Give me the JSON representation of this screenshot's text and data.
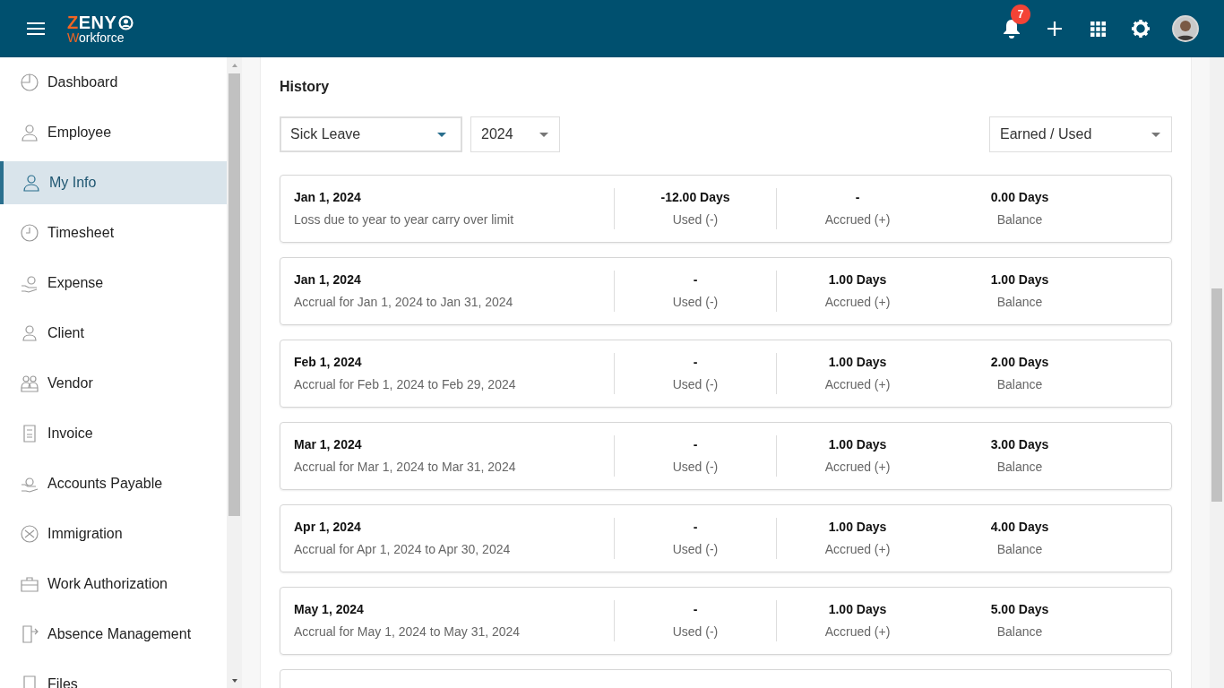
{
  "header": {
    "logo": {
      "top": "ZENY",
      "bottom": "Workforce"
    },
    "notifications": {
      "count": "7"
    }
  },
  "sidebar": {
    "items": [
      {
        "label": "Dashboard",
        "selected": false
      },
      {
        "label": "Employee",
        "selected": false
      },
      {
        "label": "My Info",
        "selected": true
      },
      {
        "label": "Timesheet",
        "selected": false
      },
      {
        "label": "Expense",
        "selected": false
      },
      {
        "label": "Client",
        "selected": false
      },
      {
        "label": "Vendor",
        "selected": false
      },
      {
        "label": "Invoice",
        "selected": false
      },
      {
        "label": "Accounts Payable",
        "selected": false
      },
      {
        "label": "Immigration",
        "selected": false
      },
      {
        "label": "Work Authorization",
        "selected": false
      },
      {
        "label": "Absence Management",
        "selected": false
      },
      {
        "label": "Files",
        "selected": false
      }
    ]
  },
  "history": {
    "title": "History",
    "filters": {
      "leave_type": "Sick Leave",
      "year": "2024",
      "view": "Earned / Used"
    },
    "records": [
      {
        "date": "Jan 1, 2024",
        "description": "Loss due to year to year carry over limit",
        "used": "-12.00 Days",
        "used_label": "Used (-)",
        "accrued": "-",
        "accrued_label": "Accrued (+)",
        "balance": "0.00 Days",
        "balance_label": "Balance"
      },
      {
        "date": "Jan 1, 2024",
        "description": "Accrual for Jan 1, 2024 to Jan 31, 2024",
        "used": "-",
        "used_label": "Used (-)",
        "accrued": "1.00 Days",
        "accrued_label": "Accrued (+)",
        "balance": "1.00 Days",
        "balance_label": "Balance"
      },
      {
        "date": "Feb 1, 2024",
        "description": "Accrual for Feb 1, 2024 to Feb 29, 2024",
        "used": "-",
        "used_label": "Used (-)",
        "accrued": "1.00 Days",
        "accrued_label": "Accrued (+)",
        "balance": "2.00 Days",
        "balance_label": "Balance"
      },
      {
        "date": "Mar 1, 2024",
        "description": "Accrual for Mar 1, 2024 to Mar 31, 2024",
        "used": "-",
        "used_label": "Used (-)",
        "accrued": "1.00 Days",
        "accrued_label": "Accrued (+)",
        "balance": "3.00 Days",
        "balance_label": "Balance"
      },
      {
        "date": "Apr 1, 2024",
        "description": "Accrual for Apr 1, 2024 to Apr 30, 2024",
        "used": "-",
        "used_label": "Used (-)",
        "accrued": "1.00 Days",
        "accrued_label": "Accrued (+)",
        "balance": "4.00 Days",
        "balance_label": "Balance"
      },
      {
        "date": "May 1, 2024",
        "description": "Accrual for May 1, 2024 to May 31, 2024",
        "used": "-",
        "used_label": "Used (-)",
        "accrued": "1.00 Days",
        "accrued_label": "Accrued (+)",
        "balance": "5.00 Days",
        "balance_label": "Balance"
      }
    ]
  }
}
